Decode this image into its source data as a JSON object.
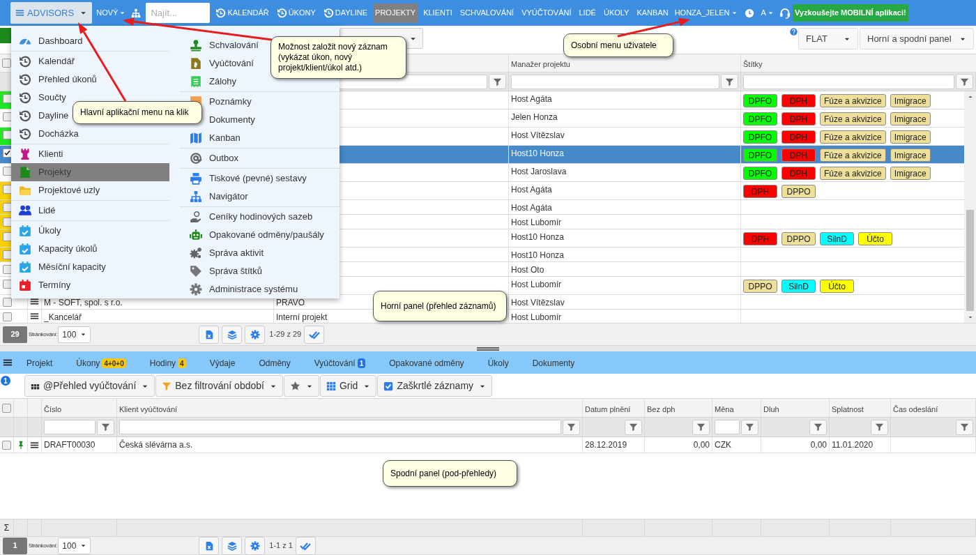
{
  "navbar": {
    "items": [
      {
        "kind": "app_menu",
        "label": "ADVISORS",
        "expanded": true
      },
      {
        "kind": "dropdown",
        "label": "NOVÝ"
      },
      {
        "kind": "sitemap"
      },
      {
        "kind": "search",
        "placeholder": "Najít..."
      },
      {
        "kind": "timer_link",
        "label": "KALENDÁŘ",
        "selected": false
      },
      {
        "kind": "timer_link",
        "label": "ÚKONY",
        "selected": false
      },
      {
        "kind": "timer_link",
        "label": "DAYLINE",
        "selected": false
      },
      {
        "kind": "link",
        "label": "PROJEKTY",
        "selected": true
      },
      {
        "kind": "link",
        "label": "KLIENTI",
        "selected": false
      },
      {
        "kind": "link",
        "label": "SCHVALOVÁNÍ",
        "selected": false
      },
      {
        "kind": "link",
        "label": "VYÚČTOVÁNÍ",
        "selected": false
      },
      {
        "kind": "link",
        "label": "LIDÉ",
        "selected": false
      },
      {
        "kind": "link",
        "label": "ÚKOLY",
        "selected": false
      },
      {
        "kind": "link",
        "label": "KANBAN",
        "selected": false
      },
      {
        "kind": "dropdown",
        "label": "HONZA_JELEN"
      },
      {
        "kind": "clock"
      },
      {
        "kind": "dropdown",
        "label": "A"
      },
      {
        "kind": "support"
      },
      {
        "kind": "promo",
        "label": "Vyzkoušejte MOBILNÍ aplikaci!"
      }
    ]
  },
  "app_menu": {
    "columns": [
      {
        "groups": [
          [
            {
              "label": "Dashboard",
              "selected": false
            }
          ],
          [
            {
              "label": "Kalendář",
              "selected": false
            },
            {
              "label": "Přehled úkonů",
              "selected": false
            },
            {
              "label": "Součty",
              "selected": false
            },
            {
              "label": "Dayline",
              "selected": false
            },
            {
              "label": "Docházka",
              "selected": false
            }
          ],
          [
            {
              "label": "Klienti",
              "selected": false
            },
            {
              "label": "Projekty",
              "selected": true
            },
            {
              "label": "Projektové uzly",
              "selected": false
            }
          ],
          [
            {
              "label": "Lidé",
              "selected": false
            }
          ],
          [
            {
              "label": "Úkoly",
              "selected": false
            },
            {
              "label": "Kapacity úkolů",
              "selected": false
            },
            {
              "label": "Měsíční kapacity",
              "selected": false
            },
            {
              "label": "Termíny",
              "selected": false
            }
          ]
        ]
      },
      {
        "groups": [
          [
            {
              "label": "Schvalování",
              "selected": false
            },
            {
              "label": "Vyúčtování",
              "selected": false
            },
            {
              "label": "Zálohy",
              "selected": false
            }
          ],
          [
            {
              "label": "Poznámky",
              "selected": false
            },
            {
              "label": "Dokumenty",
              "selected": false
            },
            {
              "label": "Kanban",
              "selected": false
            }
          ],
          [
            {
              "label": "Outbox",
              "selected": false
            }
          ],
          [
            {
              "label": "Tiskové (pevné) sestavy",
              "selected": false
            },
            {
              "label": "Navigátor",
              "selected": false
            }
          ],
          [
            {
              "label": "Ceníky hodinových sazeb",
              "selected": false
            },
            {
              "label": "Opakované odměny/paušály",
              "selected": false
            },
            {
              "label": "Správa aktivit",
              "selected": false
            },
            {
              "label": "Správa štítků",
              "selected": false
            },
            {
              "label": "Administrace systému",
              "selected": false
            }
          ]
        ]
      }
    ]
  },
  "view_toolbar": {
    "mode_select": "FLAT",
    "layout_select": "Horní a spodní panel"
  },
  "top_grid": {
    "header_checked": false,
    "manager_header": "Manažer projektu",
    "tags_header": "Štítky",
    "rows": [
      {
        "checked": false,
        "selected": false,
        "color": "#22e622",
        "manager": "Host Agáta",
        "tags": [
          {
            "label": "DPFO",
            "color": "#00ff00"
          },
          {
            "label": "DPH",
            "color": "#ff0000"
          },
          {
            "label": "Fúze a akvizice",
            "color": "#eee09a"
          },
          {
            "label": "Imigrace",
            "color": "#eee09a"
          }
        ]
      },
      {
        "checked": false,
        "selected": false,
        "manager": "Jelen Honza",
        "tags": [
          {
            "label": "DPFO",
            "color": "#00ff00"
          },
          {
            "label": "DPH",
            "color": "#ff0000"
          },
          {
            "label": "Fúze a akvizice",
            "color": "#eee09a"
          },
          {
            "label": "Imigrace",
            "color": "#eee09a"
          }
        ]
      },
      {
        "checked": false,
        "selected": false,
        "color": "#22e622",
        "manager": "Host Vítězslav",
        "tags": [
          {
            "label": "DPFO",
            "color": "#00ff00"
          },
          {
            "label": "DPH",
            "color": "#ff0000"
          },
          {
            "label": "Fúze a akvizice",
            "color": "#eee09a"
          },
          {
            "label": "Imigrace",
            "color": "#eee09a"
          }
        ]
      },
      {
        "checked": true,
        "selected": true,
        "manager": "Host10 Honza",
        "tags": [
          {
            "label": "DPFO",
            "color": "#00ff00"
          },
          {
            "label": "DPH",
            "color": "#ff0000"
          },
          {
            "label": "Fúze a akvizice",
            "color": "#eee09a"
          },
          {
            "label": "Imigrace",
            "color": "#eee09a"
          }
        ]
      },
      {
        "checked": false,
        "selected": false,
        "manager": "Host Jaroslava",
        "tags": [
          {
            "label": "DPFO",
            "color": "#00ff00"
          },
          {
            "label": "DPH",
            "color": "#ff0000"
          },
          {
            "label": "Fúze a akvizice",
            "color": "#eee09a"
          },
          {
            "label": "Imigrace",
            "color": "#eee09a"
          }
        ]
      },
      {
        "checked": false,
        "selected": false,
        "color": "#f8d000",
        "manager": "Host Agáta",
        "tags": [
          {
            "label": "DPH",
            "color": "#ff0000"
          },
          {
            "label": "DPPO",
            "color": "#eee09a"
          }
        ]
      },
      {
        "checked": false,
        "selected": false,
        "color": "#f8d000",
        "manager": "Host Agáta"
      },
      {
        "checked": false,
        "selected": false,
        "color": "#f8d000",
        "manager": "Host Lubomír"
      },
      {
        "checked": false,
        "selected": false,
        "color": "#f8d000",
        "manager": "Host10 Honza",
        "tags": [
          {
            "label": "DPH",
            "color": "#ff0000"
          },
          {
            "label": "DPPO",
            "color": "#eee09a"
          },
          {
            "label": "SilnD",
            "color": "#00ffff"
          },
          {
            "label": "Účto",
            "color": "#ffff00"
          }
        ]
      },
      {
        "checked": false,
        "selected": false,
        "color": "#f8d000",
        "manager": "Host10 Honza"
      },
      {
        "checked": false,
        "selected": false,
        "manager": "Host Oto"
      },
      {
        "checked": false,
        "selected": false,
        "manager": "Host Lubomír",
        "tags": [
          {
            "label": "DPPO",
            "color": "#eee09a"
          },
          {
            "label": "SilnD",
            "color": "#00ffff"
          },
          {
            "label": "Účto",
            "color": "#ffff00"
          }
        ]
      },
      {
        "checked": false,
        "selected": false,
        "name": "M - SOFT, spol. s r.o.",
        "column_3": "PRAVO",
        "manager": "Host Vítězslav"
      },
      {
        "checked": false,
        "selected": false,
        "name": "_Kancelář",
        "column_3": "Interní projekt",
        "manager": "Host Lubomír"
      }
    ],
    "footer": {
      "count": "29",
      "paging_label": "Stránkování:",
      "page_size": "100",
      "range": "1-29 z 29"
    }
  },
  "bottom_panel": {
    "tabs": [
      {
        "label": "Projekt",
        "selected": false
      },
      {
        "label": "Úkony",
        "selected": false,
        "badge": {
          "text": "4+0+0",
          "color": "#f7c614"
        }
      },
      {
        "label": "Hodiny",
        "selected": false,
        "badge": {
          "text": "4",
          "color": "#f7c614"
        }
      },
      {
        "label": "Výdaje",
        "selected": false
      },
      {
        "label": "Odměny",
        "selected": false
      },
      {
        "label": "Vyúčtování",
        "selected": false,
        "badge": {
          "text": "1",
          "color": "#1a73e8"
        }
      },
      {
        "label": "Opakované odměny",
        "selected": false
      },
      {
        "label": "Úkoly",
        "selected": false
      },
      {
        "label": "Dokumenty",
        "selected": false
      }
    ],
    "counter": "1",
    "toolbar": [
      {
        "kind": "view",
        "label": "@Přehled vyúčtování"
      },
      {
        "kind": "filter",
        "label": "Bez filtrování období"
      },
      {
        "kind": "favorites"
      },
      {
        "kind": "grid",
        "label": "Grid"
      },
      {
        "kind": "checked",
        "label": "Zaškrtlé záznamy"
      }
    ],
    "header_checked": false,
    "columns": [
      {
        "label": "Číslo",
        "kind": "input"
      },
      {
        "label": "Klient vyúčtování",
        "kind": "input"
      },
      {
        "label": "Datum plnění",
        "kind": "button"
      },
      {
        "label": "Bez dph",
        "kind": "button"
      },
      {
        "label": "Měna",
        "kind": "input"
      },
      {
        "label": "Dluh",
        "kind": "button"
      },
      {
        "label": "Splatnost",
        "kind": "button"
      },
      {
        "label": "Čas odeslání",
        "kind": "button"
      }
    ],
    "rows": [
      {
        "checked": false,
        "pinned": true,
        "cells": [
          "DRAFT00030",
          "Česká slévárna a.s.",
          "28.12.2019",
          "0,00",
          "CZK",
          "0,00",
          "11.01.2020"
        ]
      }
    ],
    "sum_label": "Σ",
    "footer": {
      "count": "1",
      "paging_label": "Stránkování:",
      "page_size": "100",
      "range": "1-1 z 1"
    }
  },
  "annotations": [
    {
      "text": "Hlavní aplikační menu na klik"
    },
    {
      "text": "Možnost založit nový záznam (vykázat úkon, nový projekt/klient/úkol atd.)"
    },
    {
      "text": "Osobní menu uživatele"
    },
    {
      "text": "Horní panel (přehled záznamů)"
    },
    {
      "text": "Spodní panel (pod-přehledy)"
    }
  ]
}
